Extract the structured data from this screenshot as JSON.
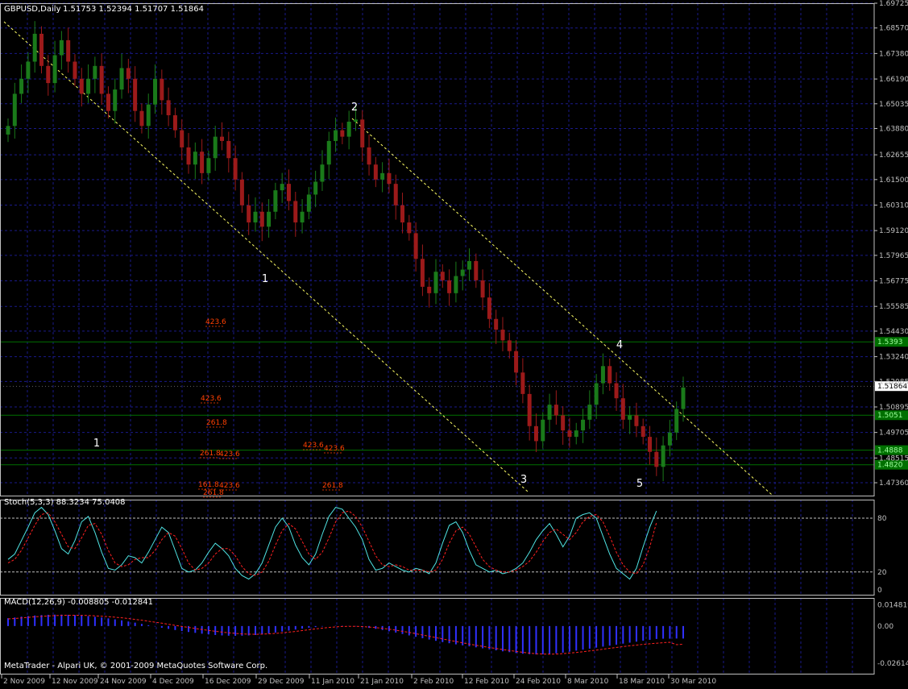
{
  "header": {
    "symbol": "GBPUSD,Daily",
    "ohlc": "1.51753 1.52394 1.51707 1.51864"
  },
  "footer": {
    "copyright": "MetaTrader - Alpari UK, © 2001-2009 MetaQuotes Software Corp."
  },
  "colors": {
    "background": "#000000",
    "grid": "#1a1a8a",
    "axis": "#c0c0c0",
    "bull": "#1a7a1a",
    "bear": "#9c1a1a",
    "trendline": "#ffff66",
    "fib": "#ff4000",
    "level": "#007000",
    "stoch_main": "#4fe3e3",
    "stoch_signal": "#ff2020",
    "macd_hist": "#3030ff",
    "macd_signal": "#ff2020"
  },
  "chart_data": [
    {
      "type": "candlestick",
      "title": "GBPUSD,Daily",
      "ylim": [
        1.4676,
        1.69725
      ],
      "y_ticks": [
        "1.69725",
        "1.68570",
        "1.67380",
        "1.66190",
        "1.65035",
        "1.63880",
        "1.62655",
        "1.61500",
        "1.60310",
        "1.59120",
        "1.57965",
        "1.56775",
        "1.55585",
        "1.54430",
        "1.53240",
        "1.52085",
        "1.50895",
        "1.49705",
        "1.48515",
        "1.47360"
      ],
      "x_ticks": [
        "2 Nov 2009",
        "12 Nov 2009",
        "24 Nov 2009",
        "4 Dec 2009",
        "16 Dec 2009",
        "29 Dec 2009",
        "11 Jan 2010",
        "21 Jan 2010",
        "2 Feb 2010",
        "12 Feb 2010",
        "24 Feb 2010",
        "8 Mar 2010",
        "18 Mar 2010",
        "30 Mar 2010"
      ],
      "close_series": [
        1.64,
        1.655,
        1.662,
        1.67,
        1.683,
        1.668,
        1.66,
        1.673,
        1.68,
        1.67,
        1.662,
        1.655,
        1.662,
        1.668,
        1.655,
        1.647,
        1.657,
        1.667,
        1.662,
        1.647,
        1.64,
        1.65,
        1.662,
        1.652,
        1.645,
        1.638,
        1.63,
        1.622,
        1.628,
        1.618,
        1.625,
        1.635,
        1.633,
        1.625,
        1.615,
        1.603,
        1.595,
        1.6,
        1.593,
        1.6,
        1.61,
        1.613,
        1.605,
        1.595,
        1.6,
        1.608,
        1.614,
        1.622,
        1.633,
        1.638,
        1.635,
        1.642,
        1.643,
        1.63,
        1.622,
        1.615,
        1.618,
        1.613,
        1.603,
        1.595,
        1.59,
        1.578,
        1.565,
        1.562,
        1.572,
        1.568,
        1.562,
        1.57,
        1.573,
        1.577,
        1.568,
        1.56,
        1.55,
        1.545,
        1.54,
        1.535,
        1.525,
        1.515,
        1.5,
        1.493,
        1.503,
        1.51,
        1.505,
        1.498,
        1.495,
        1.498,
        1.503,
        1.51,
        1.52,
        1.528,
        1.52,
        1.513,
        1.503,
        1.505,
        1.5,
        1.495,
        1.488,
        1.481,
        1.491,
        1.497,
        1.508,
        1.518
      ],
      "current_price": "1.51864",
      "horizontal_levels": [
        {
          "label": "1.5393",
          "value": 1.5393
        },
        {
          "label": "1.5051",
          "value": 1.5051
        },
        {
          "label": "1.4888",
          "value": 1.4888
        },
        {
          "label": "1.4820",
          "value": 1.482
        }
      ],
      "wave_labels": [
        {
          "text": "1",
          "date": "29 Dec 2009",
          "price": 1.572
        },
        {
          "text": "2",
          "date": "11 Jan 2010",
          "price": 1.651
        },
        {
          "text": "3",
          "date": "24 Feb 2010",
          "price": 1.478
        },
        {
          "text": "4",
          "date": "18 Mar 2010",
          "price": 1.541
        },
        {
          "text": "5",
          "date": "18 Mar 2010",
          "price": 1.476
        },
        {
          "text": "1",
          "date": "2 Nov 2009",
          "price": 1.501
        }
      ],
      "fib_labels": [
        "423.6",
        "423.6",
        "261.8",
        "261.8",
        "423.6",
        "423.6",
        "423.6",
        "261.8",
        "161.8",
        "423.6",
        "261.8"
      ]
    },
    {
      "type": "line",
      "title": "Stoch(5,3,3) 88.3234 75.0408",
      "ylim": [
        0,
        100
      ],
      "y_ticks": [
        "80",
        "20",
        "0"
      ],
      "levels": [
        80,
        20
      ],
      "series": [
        {
          "name": "main",
          "values": [
            34,
            40,
            55,
            70,
            86,
            92,
            84,
            66,
            46,
            40,
            55,
            76,
            82,
            64,
            42,
            24,
            22,
            28,
            38,
            36,
            30,
            42,
            56,
            70,
            64,
            44,
            24,
            20,
            22,
            30,
            42,
            52,
            46,
            38,
            24,
            16,
            12,
            18,
            30,
            50,
            70,
            80,
            70,
            50,
            36,
            28,
            40,
            62,
            82,
            92,
            90,
            80,
            70,
            56,
            34,
            22,
            24,
            30,
            26,
            22,
            20,
            24,
            22,
            18,
            30,
            52,
            72,
            76,
            64,
            44,
            28,
            24,
            20,
            22,
            18,
            20,
            24,
            30,
            42,
            56,
            66,
            74,
            62,
            48,
            60,
            80,
            84,
            86,
            80,
            60,
            40,
            24,
            18,
            12,
            24,
            48,
            70,
            88
          ]
        },
        {
          "name": "signal",
          "values": [
            30,
            34,
            44,
            58,
            72,
            84,
            86,
            76,
            62,
            48,
            46,
            58,
            72,
            74,
            62,
            44,
            30,
            26,
            28,
            34,
            36,
            36,
            44,
            56,
            64,
            60,
            46,
            30,
            22,
            24,
            30,
            40,
            46,
            46,
            38,
            26,
            18,
            16,
            20,
            32,
            50,
            66,
            74,
            68,
            54,
            40,
            34,
            42,
            58,
            76,
            86,
            88,
            82,
            70,
            54,
            38,
            28,
            26,
            28,
            26,
            22,
            22,
            22,
            20,
            22,
            34,
            52,
            66,
            70,
            62,
            48,
            34,
            26,
            22,
            20,
            20,
            22,
            26,
            32,
            42,
            54,
            64,
            68,
            62,
            56,
            64,
            76,
            82,
            84,
            76,
            60,
            42,
            28,
            20,
            18,
            28,
            48,
            75
          ]
        }
      ]
    },
    {
      "type": "bar",
      "title": "MACD(12,26,9) -0.008805 -0.012841",
      "ylim": [
        -0.029,
        0.0175
      ],
      "y_ticks": [
        "0.014819",
        "0.00",
        "-0.026147"
      ],
      "series": [
        {
          "name": "macd",
          "values": [
            0.0055,
            0.006,
            0.0066,
            0.007,
            0.0074,
            0.0077,
            0.0079,
            0.008,
            0.008,
            0.0079,
            0.0077,
            0.0074,
            0.007,
            0.0065,
            0.006,
            0.0054,
            0.0047,
            0.004,
            0.0032,
            0.0024,
            0.0015,
            0.0006,
            -0.0003,
            -0.0012,
            -0.002,
            -0.0028,
            -0.0035,
            -0.0042,
            -0.0048,
            -0.0054,
            -0.0059,
            -0.0063,
            -0.0066,
            -0.0068,
            -0.0069,
            -0.0068,
            -0.0066,
            -0.0063,
            -0.0058,
            -0.0053,
            -0.0046,
            -0.0039,
            -0.0032,
            -0.0025,
            -0.0018,
            -0.0012,
            -0.0007,
            -0.0003,
            0.0,
            0.0002,
            0.0002,
            0.0001,
            -0.0002,
            -0.0007,
            -0.0013,
            -0.002,
            -0.0028,
            -0.0037,
            -0.0046,
            -0.0056,
            -0.0066,
            -0.0076,
            -0.0086,
            -0.0095,
            -0.0104,
            -0.0113,
            -0.0121,
            -0.0129,
            -0.0136,
            -0.0143,
            -0.015,
            -0.0157,
            -0.0164,
            -0.0171,
            -0.0178,
            -0.0184,
            -0.019,
            -0.0195,
            -0.0198,
            -0.02,
            -0.0199,
            -0.0196,
            -0.0192,
            -0.0187,
            -0.018,
            -0.0173,
            -0.0166,
            -0.0159,
            -0.0152,
            -0.0145,
            -0.0138,
            -0.0131,
            -0.0124,
            -0.0117,
            -0.011,
            -0.0103,
            -0.0097,
            -0.0091,
            -0.0089,
            -0.0089,
            -0.0088,
            -0.0088
          ]
        },
        {
          "name": "signal",
          "values": [
            0.005,
            0.0053,
            0.0057,
            0.0061,
            0.0065,
            0.0068,
            0.0071,
            0.0073,
            0.0075,
            0.0076,
            0.0076,
            0.0075,
            0.0074,
            0.0072,
            0.0069,
            0.0066,
            0.0062,
            0.0058,
            0.0053,
            0.0047,
            0.0041,
            0.0034,
            0.0027,
            0.002,
            0.0012,
            0.0005,
            -0.0003,
            -0.001,
            -0.0017,
            -0.0024,
            -0.0031,
            -0.0037,
            -0.0043,
            -0.0048,
            -0.0052,
            -0.0055,
            -0.0057,
            -0.0058,
            -0.0057,
            -0.0055,
            -0.0052,
            -0.0048,
            -0.0043,
            -0.0038,
            -0.0032,
            -0.0026,
            -0.002,
            -0.0015,
            -0.001,
            -0.0006,
            -0.0003,
            -0.0002,
            -0.0002,
            -0.0004,
            -0.0007,
            -0.0011,
            -0.0016,
            -0.0022,
            -0.0029,
            -0.0037,
            -0.0045,
            -0.0054,
            -0.0063,
            -0.0072,
            -0.0082,
            -0.0091,
            -0.01,
            -0.0109,
            -0.0118,
            -0.0127,
            -0.0135,
            -0.0143,
            -0.0151,
            -0.0158,
            -0.0165,
            -0.0172,
            -0.0179,
            -0.0185,
            -0.0191,
            -0.0195,
            -0.0197,
            -0.0198,
            -0.0197,
            -0.0194,
            -0.019,
            -0.0186,
            -0.0181,
            -0.0175,
            -0.0169,
            -0.0163,
            -0.0157,
            -0.0151,
            -0.0145,
            -0.0139,
            -0.0134,
            -0.0129,
            -0.0125,
            -0.0121,
            -0.0117,
            -0.0114,
            -0.0131,
            -0.0128
          ]
        }
      ]
    }
  ]
}
